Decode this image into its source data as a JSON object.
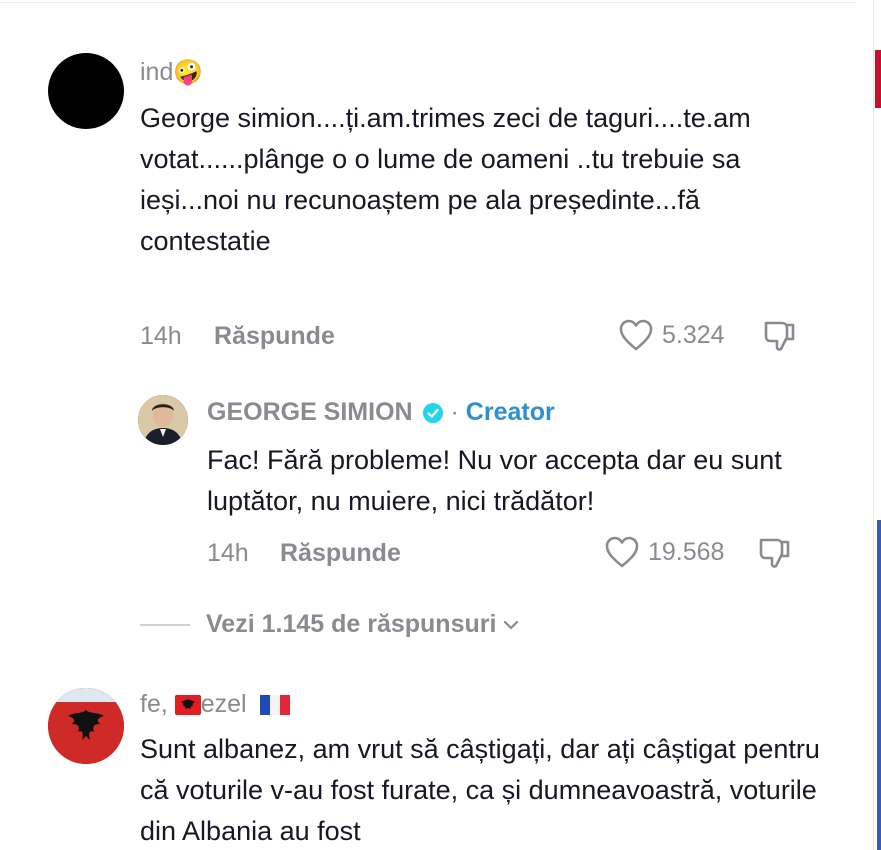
{
  "comments": [
    {
      "username": "ind",
      "username_emoji": "🤪",
      "text": "George simion....ți.am.trimes zeci de taguri....te.am votat......plânge o o lume de oameni ..tu trebuie sa ieși...noi nu recunoaștem pe ala președinte...fă contestatie",
      "time": "14h",
      "reply_label": "Răspunde",
      "likes": "5.324"
    },
    {
      "username": "GEORGE SIMION",
      "badge": "Creator",
      "separator": "·",
      "text": "Fac! Fără probleme! Nu vor accepta dar eu sunt luptător, nu muiere, nici trădător!",
      "time": "14h",
      "reply_label": "Răspunde",
      "likes": "19.568"
    },
    {
      "username_a": "fe,",
      "username_b": "ezel",
      "text": "Sunt albanez, am vrut să câștigați, dar ați câștigat pentru că voturile v-au fost furate, ca și dumneavoastră, voturile din Albania au fost"
    }
  ],
  "view_replies": "Vezi 1.145 de răspunsuri",
  "icons": {
    "like": "heart-outline-icon",
    "dislike": "thumbs-down-icon",
    "expand": "chevron-down-icon",
    "verified": "verified-check-icon"
  },
  "colors": {
    "accent": "#2f8fd6",
    "muted": "#8a8b91",
    "text": "#161823"
  }
}
